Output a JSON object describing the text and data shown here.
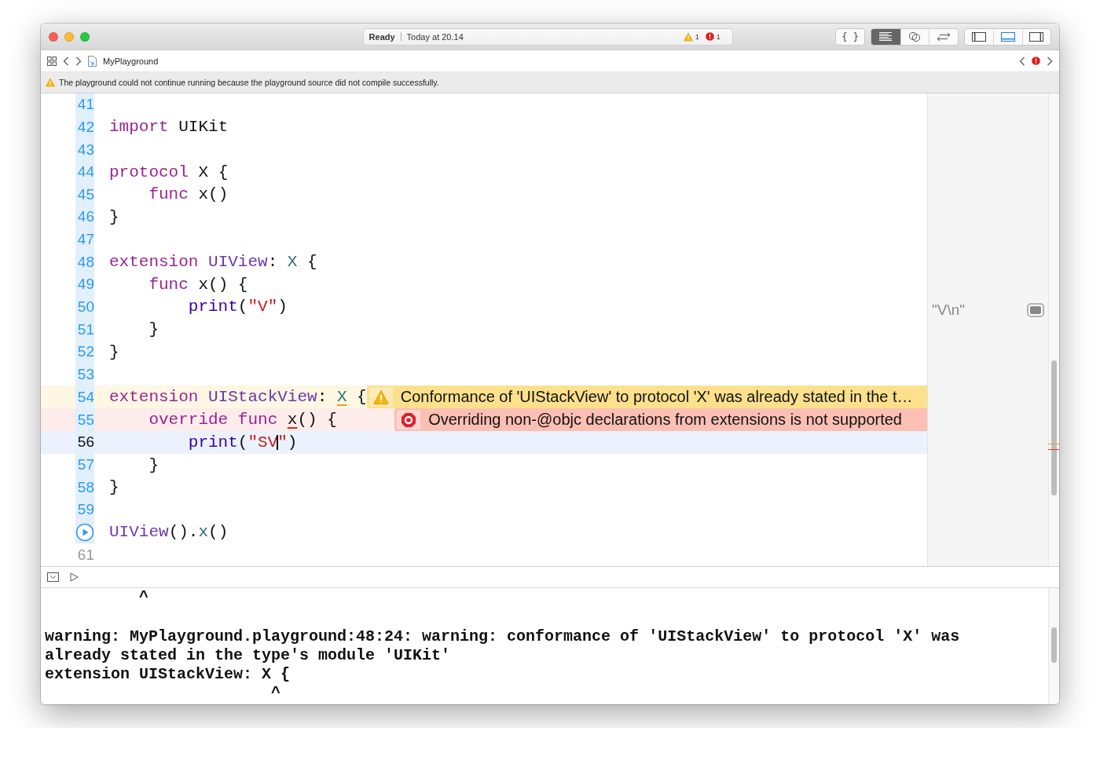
{
  "toolbar": {
    "status": {
      "state": "Ready",
      "time": "Today at 20.14",
      "warnings": "1",
      "errors": "1"
    },
    "braces_button": {
      "label": "{ }"
    },
    "editor_modes": [
      {
        "kind": "standard",
        "selected": true
      },
      {
        "kind": "assistant",
        "selected": false
      },
      {
        "kind": "version",
        "selected": false
      }
    ],
    "layout_toggles": [
      {
        "kind": "navigator",
        "selected": false
      },
      {
        "kind": "debug",
        "selected": true
      },
      {
        "kind": "utilities",
        "selected": false
      }
    ]
  },
  "breadcrumb": {
    "file": "MyPlayground"
  },
  "banner": {
    "text": "The playground could not continue running because the playground source did not compile successfully."
  },
  "editor": {
    "lines": [
      {
        "kind": "number",
        "number": "41",
        "ran": true,
        "current": false
      },
      {
        "kind": "number",
        "number": "42",
        "ran": true,
        "current": false,
        "tokens": [
          {
            "text": "import",
            "kind": "keyword"
          },
          {
            "text": " UIKit",
            "kind": "plain"
          }
        ]
      },
      {
        "kind": "number",
        "number": "43",
        "ran": true,
        "current": false
      },
      {
        "kind": "number",
        "number": "44",
        "ran": true,
        "current": false,
        "tokens": [
          {
            "text": "protocol",
            "kind": "keyword"
          },
          {
            "text": " X {",
            "kind": "plain"
          }
        ]
      },
      {
        "kind": "number",
        "number": "45",
        "ran": true,
        "current": false,
        "tokens": [
          {
            "text": "    func",
            "kind": "keyword"
          },
          {
            "text": " x()",
            "kind": "plain"
          }
        ]
      },
      {
        "kind": "number",
        "number": "46",
        "ran": true,
        "current": false,
        "tokens": [
          {
            "text": "}",
            "kind": "plain"
          }
        ]
      },
      {
        "kind": "number",
        "number": "47",
        "ran": true,
        "current": false
      },
      {
        "kind": "number",
        "number": "48",
        "ran": true,
        "current": false,
        "tokens": [
          {
            "text": "extension",
            "kind": "keyword"
          },
          {
            "text": " UIView",
            "kind": "type"
          },
          {
            "text": ": ",
            "kind": "plain"
          },
          {
            "text": "X",
            "kind": "member"
          },
          {
            "text": " {",
            "kind": "plain"
          }
        ]
      },
      {
        "kind": "number",
        "number": "49",
        "ran": true,
        "current": false,
        "tokens": [
          {
            "text": "    func",
            "kind": "keyword"
          },
          {
            "text": " x() {",
            "kind": "plain"
          }
        ]
      },
      {
        "kind": "number",
        "number": "50",
        "ran": true,
        "current": false,
        "result": "\"V\\n\"",
        "tokens": [
          {
            "text": "        print",
            "kind": "call"
          },
          {
            "text": "(",
            "kind": "plain"
          },
          {
            "text": "\"V\"",
            "kind": "string"
          },
          {
            "text": ")",
            "kind": "plain"
          }
        ]
      },
      {
        "kind": "number",
        "number": "51",
        "ran": true,
        "current": false,
        "tokens": [
          {
            "text": "    }",
            "kind": "plain"
          }
        ]
      },
      {
        "kind": "number",
        "number": "52",
        "ran": true,
        "current": false,
        "tokens": [
          {
            "text": "}",
            "kind": "plain"
          }
        ]
      },
      {
        "kind": "number",
        "number": "53",
        "ran": true,
        "current": false
      },
      {
        "kind": "number",
        "number": "54",
        "ran": true,
        "current": false,
        "issue": {
          "kind": "warning",
          "text": "Conformance of 'UIStackView' to protocol 'X' was already stated in the t…"
        },
        "tokens": [
          {
            "text": "extension",
            "kind": "keyword"
          },
          {
            "text": " UIStackView",
            "kind": "type"
          },
          {
            "text": ": ",
            "kind": "plain"
          },
          {
            "text": "X",
            "kind": "member",
            "underlined": true
          },
          {
            "text": " {",
            "kind": "plain"
          }
        ]
      },
      {
        "kind": "number",
        "number": "55",
        "ran": true,
        "current": false,
        "issue": {
          "kind": "error",
          "text": "Overriding non-@objc declarations from extensions is not supported"
        },
        "tokens": [
          {
            "text": "    override func ",
            "kind": "keyword"
          },
          {
            "text": "x",
            "kind": "plain",
            "underlined": true
          },
          {
            "text": "() {",
            "kind": "plain"
          }
        ]
      },
      {
        "kind": "number",
        "number": "56",
        "ran": true,
        "current": true,
        "tokens": [
          {
            "text": "        print",
            "kind": "call"
          },
          {
            "text": "(",
            "kind": "plain"
          },
          {
            "text": "\"SV",
            "kind": "string",
            "caret": true
          },
          {
            "text": "\"",
            "kind": "string"
          },
          {
            "text": ")",
            "kind": "plain"
          }
        ]
      },
      {
        "kind": "number",
        "number": "57",
        "ran": true,
        "current": false,
        "tokens": [
          {
            "text": "    }",
            "kind": "plain"
          }
        ]
      },
      {
        "kind": "number",
        "number": "58",
        "ran": true,
        "current": false,
        "tokens": [
          {
            "text": "}",
            "kind": "plain"
          }
        ]
      },
      {
        "kind": "number",
        "number": "59",
        "ran": true,
        "current": false
      },
      {
        "kind": "run",
        "ran": true,
        "current": false,
        "tokens": [
          {
            "text": "UIView",
            "kind": "type"
          },
          {
            "text": "().",
            "kind": "plain"
          },
          {
            "text": "x",
            "kind": "member"
          },
          {
            "text": "()",
            "kind": "plain"
          }
        ]
      },
      {
        "kind": "number",
        "number": "61",
        "ran": false,
        "current": false
      }
    ]
  },
  "console": {
    "blocks": [
      {
        "lines": [
          "          ^"
        ]
      },
      {
        "lines": [
          "warning: MyPlayground.playground:48:24: warning: conformance of 'UIStackView' to protocol 'X' was",
          "already stated in the type's module 'UIKit'",
          "extension UIStackView: X {",
          "                        ^"
        ]
      }
    ]
  }
}
